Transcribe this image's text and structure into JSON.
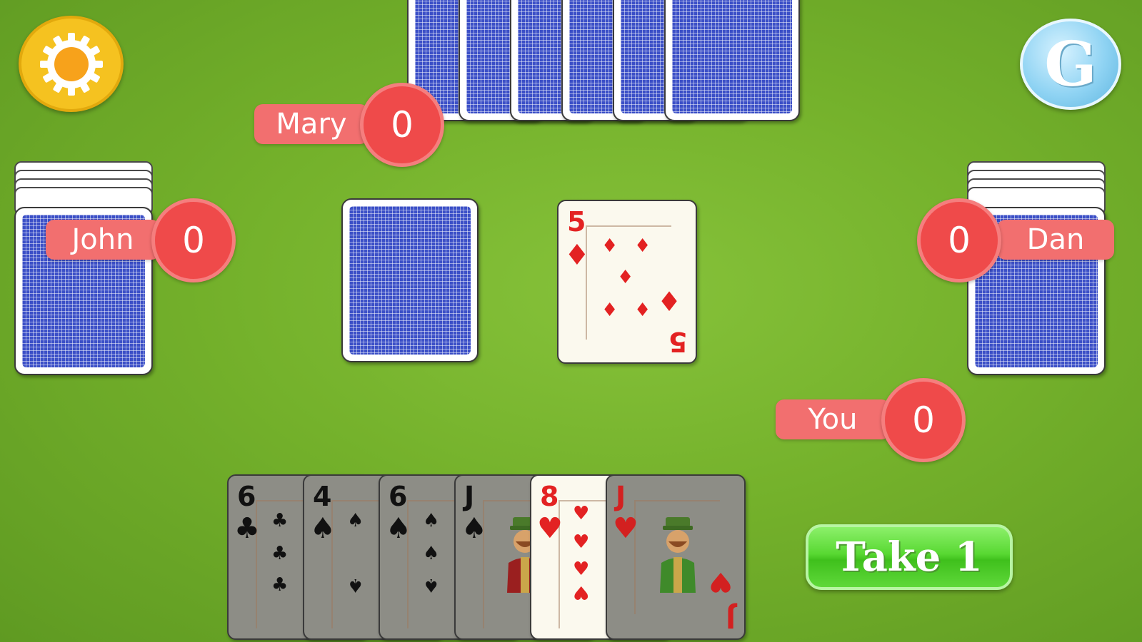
{
  "players": {
    "mary": {
      "name": "Mary",
      "score": "0"
    },
    "john": {
      "name": "John",
      "score": "0"
    },
    "dan": {
      "name": "Dan",
      "score": "0"
    },
    "you": {
      "name": "You",
      "score": "0"
    }
  },
  "discard": {
    "rank": "5",
    "suit": "♦",
    "color": "red"
  },
  "hand": [
    {
      "rank": "6",
      "suit": "♣",
      "color": "black"
    },
    {
      "rank": "4",
      "suit": "♠",
      "color": "black"
    },
    {
      "rank": "6",
      "suit": "♠",
      "color": "black"
    },
    {
      "rank": "J",
      "suit": "♠",
      "color": "black"
    },
    {
      "rank": "8",
      "suit": "♥",
      "color": "red"
    },
    {
      "rank": "J",
      "suit": "♥",
      "color": "red"
    }
  ],
  "buttons": {
    "take_label": "Take 1",
    "g_label": "G",
    "settings_icon": "gear-icon"
  },
  "colors": {
    "felt": "#74b12b",
    "score_badge": "#ef4a4a",
    "name_tag": "#f26f6f",
    "card_back": "#3b4fc7",
    "take_button": "#58d832"
  }
}
